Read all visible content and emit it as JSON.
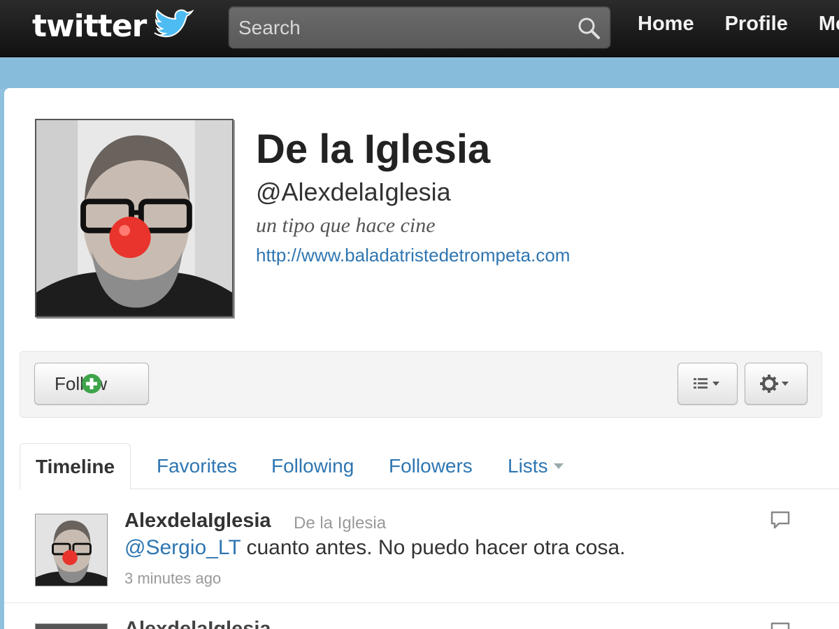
{
  "topbar": {
    "logo_text": "twitter",
    "search_placeholder": "Search",
    "nav": [
      "Home",
      "Profile",
      "Me"
    ]
  },
  "profile": {
    "display_name": "De la Iglesia",
    "screen_name": "@AlexdelaIglesia",
    "bio": "un tipo que hace cine",
    "url": "http://www.baladatristedetrompeta.com"
  },
  "actions": {
    "follow_label": "Follow"
  },
  "tabs": [
    {
      "label": "Timeline",
      "active": true
    },
    {
      "label": "Favorites"
    },
    {
      "label": "Following"
    },
    {
      "label": "Followers"
    },
    {
      "label": "Lists"
    }
  ],
  "tweets": [
    {
      "username": "AlexdelaIglesia",
      "fullname": "De la Iglesia",
      "mention": "@Sergio_LT",
      "text": " cuanto antes. No puedo hacer otra cosa.",
      "time": "3 minutes ago"
    },
    {
      "username": "AlexdelaIglesia"
    }
  ],
  "colors": {
    "topbar": "#1a1a1a",
    "band": "#87bcda",
    "link": "#2f76b1",
    "follow_green": "#4caf50"
  }
}
